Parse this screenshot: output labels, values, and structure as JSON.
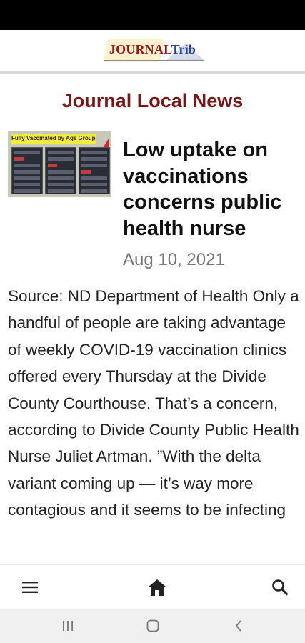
{
  "header": {
    "logo_journal": "JOURNAL",
    "logo_trib": "Trib"
  },
  "section": {
    "title": "Journal Local News"
  },
  "article": {
    "thumbnail_caption": "Fully Vaccinated by Age Groups",
    "headline": "Low uptake on vaccinations concerns public health nurse",
    "date": "Aug 10, 2021",
    "body": " Source: ND Department of Health Only a handful of people are taking advantage of weekly COVID-19 vaccination clinics offered every Thursday at the Divide County Courthouse. That’s a concern, according to Divide County Public Health Nurse Juliet Artman. ”With the delta variant coming up — it’s way more contagious and it seems to be infecting"
  },
  "bottom_nav": {
    "items": [
      "menu-icon",
      "home-icon",
      "search-icon"
    ]
  },
  "system_nav": {
    "items": [
      "recent-apps-icon",
      "home-circle-icon",
      "back-icon"
    ]
  },
  "colors": {
    "section_title": "#7a1616",
    "logo_red": "#9b1515",
    "logo_blue": "#2b3f8f",
    "date": "#757575"
  }
}
